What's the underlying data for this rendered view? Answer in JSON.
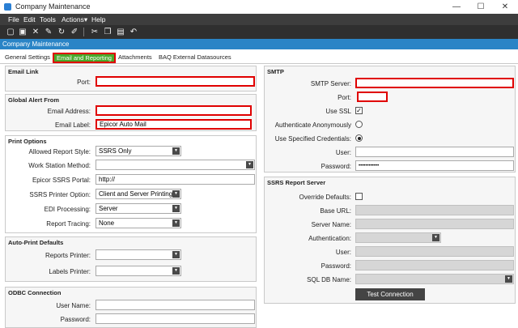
{
  "window": {
    "title": "Company Maintenance",
    "header": "Company Maintenance",
    "minimize": "—",
    "maximize": "☐",
    "close": "✕"
  },
  "menu": [
    "File",
    "Edit",
    "Tools",
    "Actions▾",
    "Help"
  ],
  "tabs": [
    "General Settings",
    "Email and Reporting",
    "Attachments",
    "BAQ External Datasources"
  ],
  "email_link": {
    "title": "Email Link",
    "port_label": "Port:",
    "port_value": ""
  },
  "global_alert": {
    "title": "Global Alert From",
    "email_label": "Email Address:",
    "email_value": "",
    "label_label": "Email Label:",
    "label_value": "Epicor Auto Mail"
  },
  "print_options": {
    "title": "Print Options",
    "allowed_style_label": "Allowed Report Style:",
    "allowed_style_value": "SSRS Only",
    "workstation_label": "Work Station Method:",
    "workstation_value": "",
    "portal_label": "Epicor SSRS Portal:",
    "portal_value": "http://",
    "printer_option_label": "SSRS Printer Option:",
    "printer_option_value": "Client and Server Printing",
    "edi_label": "EDI Processing:",
    "edi_value": "Server",
    "tracing_label": "Report Tracing:",
    "tracing_value": "None"
  },
  "auto_print": {
    "title": "Auto-Print Defaults",
    "reports_label": "Reports Printer:",
    "labels_label": "Labels Printer:"
  },
  "odbc": {
    "title": "ODBC Connection",
    "user_label": "User Name:",
    "password_label": "Password:"
  },
  "smtp": {
    "title": "SMTP",
    "server_label": "SMTP Server:",
    "server_value": "",
    "port_label": "Port:",
    "port_value": "",
    "ssl_label": "Use SSL",
    "ssl_mark": "✓",
    "anon_label": "Authenticate Anonymously",
    "specified_label": "Use Specified Credentials:",
    "user_label": "User:",
    "user_value": "",
    "password_label": "Password:",
    "password_value": "••••••••••••"
  },
  "ssrs": {
    "title": "SSRS Report Server",
    "override_label": "Override Defaults:",
    "base_url_label": "Base URL:",
    "server_name_label": "Server Name:",
    "auth_label": "Authentication:",
    "user_label": "User:",
    "password_label": "Password:",
    "sqldb_label": "SQL DB Name:",
    "test_button": "Test Connection"
  },
  "dropdown_glyph": "▼",
  "colors": {
    "menubar": "#3d3d3d",
    "toolbar": "#2f2f2f",
    "header": "#2a84c6",
    "active_tab": "#49a92b",
    "highlight": "#e00000"
  }
}
